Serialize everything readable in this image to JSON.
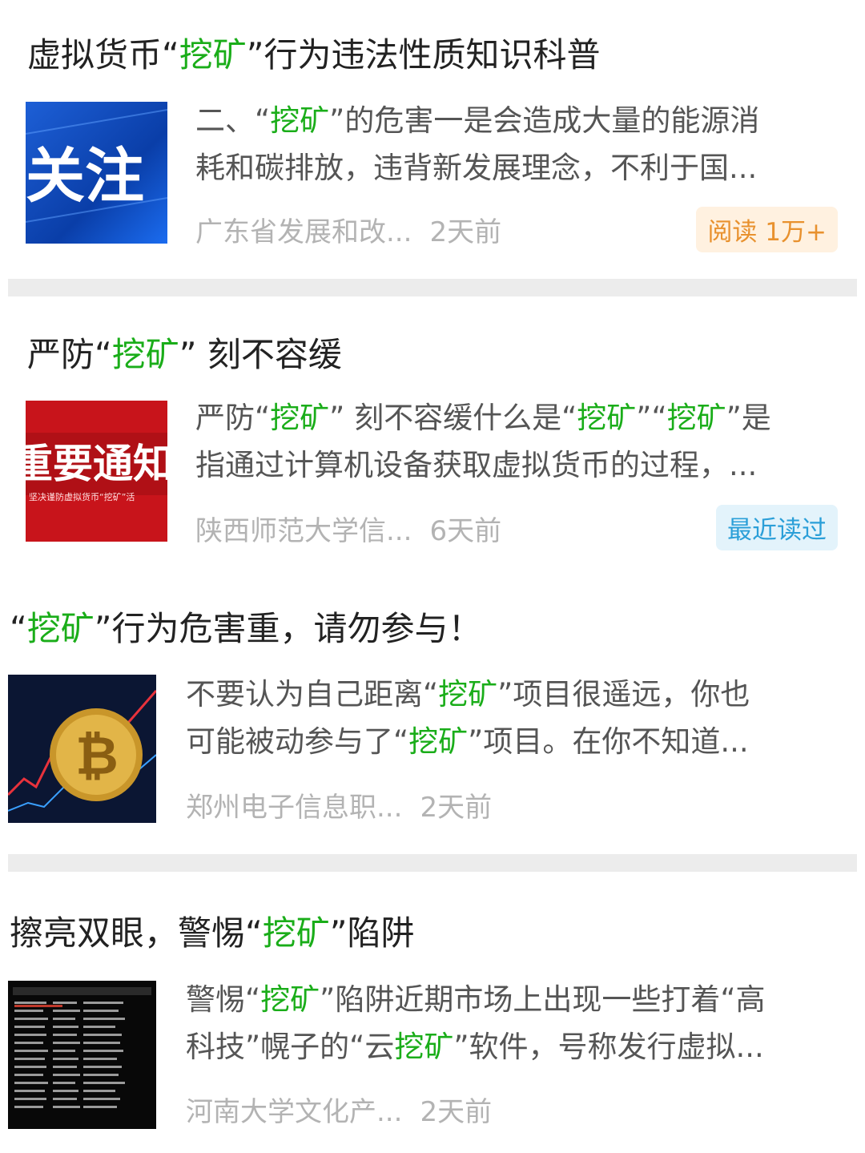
{
  "colors": {
    "keyword": "#1aad19",
    "read_badge_bg": "#fff1e0",
    "read_badge_fg": "#e8912e",
    "recent_badge_bg": "#e3f3fb",
    "recent_badge_fg": "#2b9fd8"
  },
  "articles": [
    {
      "title": [
        "虚拟货币“",
        "挖矿",
        "”行为违法性质知识科普"
      ],
      "thumb_text": "关注",
      "snippet_l1": [
        "二、“",
        "挖矿",
        "”的危害一是会造成大量的能源消"
      ],
      "snippet_l2": [
        "耗和碳排放，违背新发展理念，不利于国..."
      ],
      "source": "广东省发展和改...",
      "time": "2天前",
      "badge": "阅读 1万+"
    },
    {
      "title": [
        "严防“",
        "挖矿",
        "” 刻不容缓"
      ],
      "thumb_text": "重要通知",
      "thumb_subtext": "坚决谨防虚拟货币“挖矿”活",
      "snippet_l1": [
        "严防“",
        "挖矿",
        "” 刻不容缓什么是“",
        "挖矿",
        "”“",
        "挖矿",
        "”是"
      ],
      "snippet_l2": [
        "指通过计算机设备获取虚拟货币的过程，..."
      ],
      "source": "陕西师范大学信...",
      "time": "6天前",
      "badge": "最近读过"
    },
    {
      "title": [
        "“",
        "挖矿",
        "”行为危害重，请勿参与！"
      ],
      "thumb_text": "₿",
      "snippet_l1": [
        "不要认为自己距离“",
        "挖矿",
        "”项目很遥远，你也"
      ],
      "snippet_l2": [
        "可能被动参与了“",
        "挖矿",
        "”项目。在你不知道..."
      ],
      "source": "郑州电子信息职...",
      "time": "2天前"
    },
    {
      "title": [
        "擦亮双眼，警惕“",
        "挖矿",
        "”陷阱"
      ],
      "thumb_text": "",
      "snippet_l1": [
        "警惕“",
        "挖矿",
        "”陷阱近期市场上出现一些打着“高"
      ],
      "snippet_l2": [
        "科技”幌子的“云",
        "挖矿",
        "”软件，号称发行虚拟..."
      ],
      "source": "河南大学文化产...",
      "time": "2天前"
    }
  ]
}
